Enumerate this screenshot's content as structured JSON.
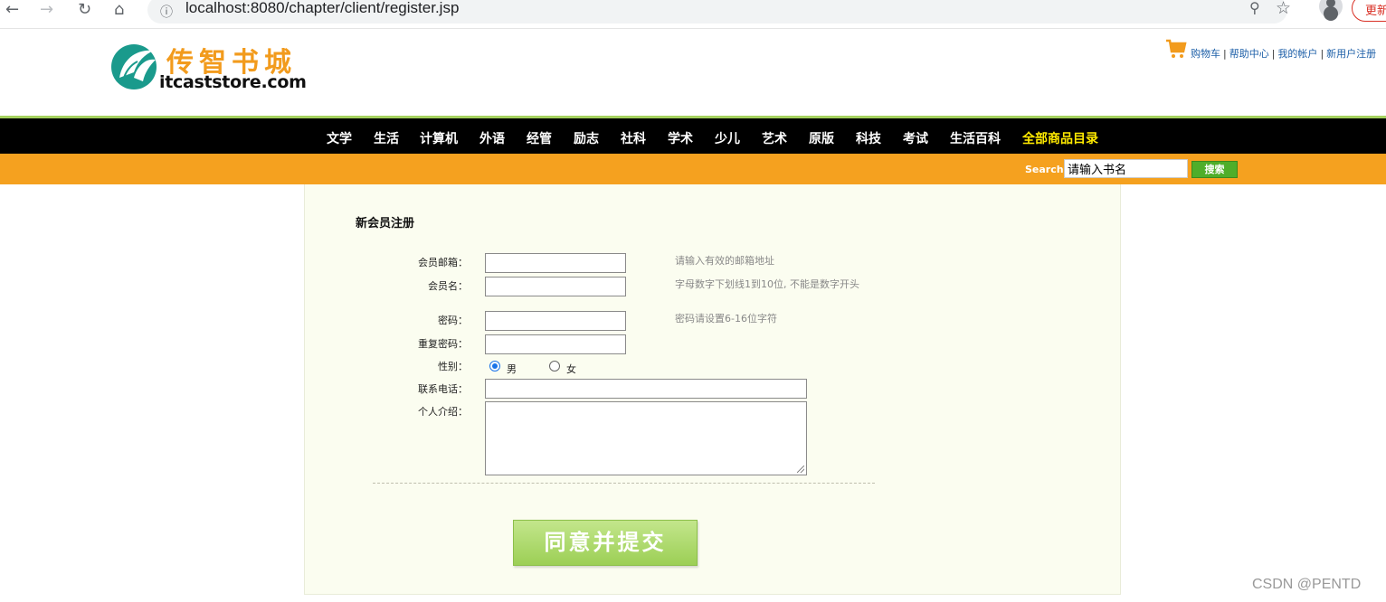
{
  "browser": {
    "url": "localhost:8080/chapter/client/register.jsp",
    "update_label": "更新"
  },
  "header": {
    "logo_cn": "传智书城",
    "logo_en": "itcaststore.com",
    "links": [
      "购物车",
      "帮助中心",
      "我的帐户",
      "新用户注册"
    ],
    "separator": "|"
  },
  "nav": {
    "categories": [
      "文学",
      "生活",
      "计算机",
      "外语",
      "经管",
      "励志",
      "社科",
      "学术",
      "少儿",
      "艺术",
      "原版",
      "科技",
      "考试",
      "生活百科"
    ],
    "all_label": "全部商品目录",
    "all_color": "#ffea00"
  },
  "search": {
    "label": "Search",
    "value": "请输入书名",
    "button": "搜索"
  },
  "form": {
    "title": "新会员注册",
    "email_label": "会员邮箱：",
    "email_hint": "请输入有效的邮箱地址",
    "username_label": "会员名：",
    "username_hint": "字母数字下划线1到10位, 不能是数字开头",
    "password_label": "密码：",
    "password_hint": "密码请设置6-16位字符",
    "repassword_label": "重复密码：",
    "gender_label": "性别：",
    "gender_male": "男",
    "gender_female": "女",
    "gender_selected": "男",
    "phone_label": "联系电话：",
    "intro_label": "个人介绍：",
    "submit": "同意并提交"
  },
  "watermark": "CSDN @PENTD",
  "colors": {
    "nav_bg": "#000000",
    "search_bar": "#f5a11f",
    "panel_bg": "#fbfdf0",
    "submit": "#9ccf55"
  }
}
